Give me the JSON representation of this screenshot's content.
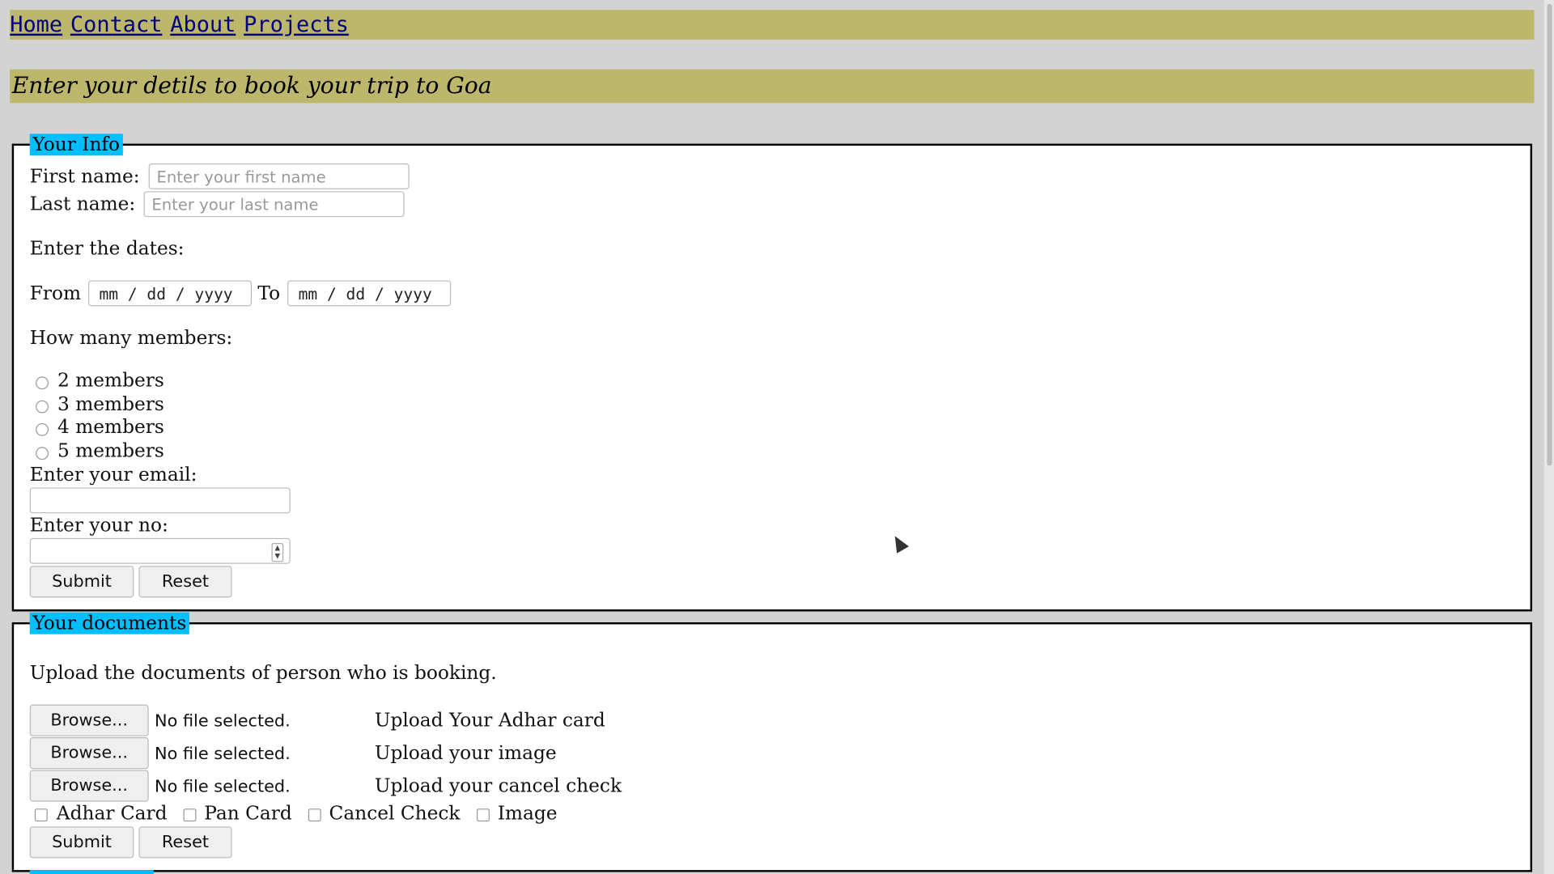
{
  "nav": {
    "links": [
      "Home",
      "Contact",
      "About",
      "Projects"
    ]
  },
  "banner": {
    "text": "Enter your detils to book your trip to Goa"
  },
  "info": {
    "legend": "Your Info",
    "first_name_label": "First name:",
    "first_name_placeholder": "Enter your first name",
    "last_name_label": "Last name:",
    "last_name_placeholder": "Enter your last name",
    "dates_label": "Enter the dates:",
    "from_label": "From",
    "to_label": "To",
    "date_placeholder": "mm / dd / yyyy",
    "members_label": "How many members:",
    "members": [
      "2 members",
      "3 members",
      "4 members",
      "5 members"
    ],
    "email_label": "Enter your email:",
    "number_label": "Enter your no:",
    "submit": "Submit",
    "reset": "Reset"
  },
  "docs": {
    "legend": "Your documents",
    "instructions": "Upload the documents of person who is booking.",
    "browse_label": "Browse...",
    "file_status": "No file selected.",
    "uploads": [
      "Upload Your Adhar card",
      "Upload your image",
      "Upload your cancel check"
    ],
    "checkboxes": [
      "Adhar Card",
      "Pan Card",
      "Cancel Check",
      "Image"
    ],
    "submit": "Submit",
    "reset": "Reset"
  },
  "colors": {
    "nav_bg": "#bdb76b",
    "legend_bg": "#00bfff",
    "page_bg": "#d3d3d3",
    "link": "#000080"
  }
}
